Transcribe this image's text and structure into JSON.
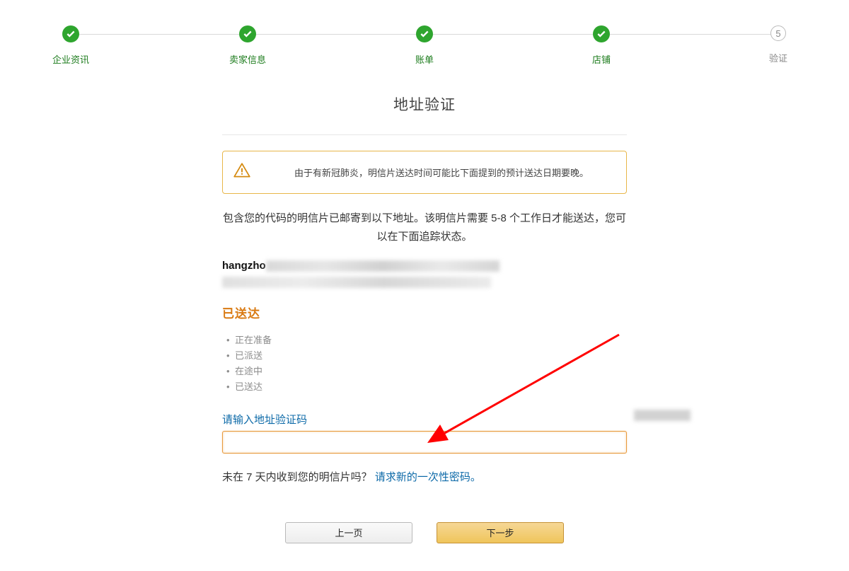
{
  "stepper": {
    "steps": [
      {
        "label": "企业资讯",
        "state": "done"
      },
      {
        "label": "卖家信息",
        "state": "done"
      },
      {
        "label": "账单",
        "state": "done"
      },
      {
        "label": "店铺",
        "state": "done"
      },
      {
        "label": "验证",
        "state": "pending",
        "number": "5"
      }
    ]
  },
  "title": "地址验证",
  "alert": {
    "text": "由于有新冠肺炎，明信片送达时间可能比下面提到的预计送达日期要晚。"
  },
  "intro": "包含您的代码的明信片已邮寄到以下地址。该明信片需要 5-8 个工作日才能送达，您可以在下面追踪状态。",
  "address": {
    "name_visible": "hangzho"
  },
  "status_title": "已送达",
  "status_items": [
    "正在准备",
    "已派送",
    "在途中",
    "已送达"
  ],
  "code": {
    "label": "请输入地址验证码",
    "value": ""
  },
  "request": {
    "prefix": "未在 7 天内收到您的明信片吗？ ",
    "link": "请求新的一次性密码。"
  },
  "buttons": {
    "prev": "上一页",
    "next": "下一步"
  }
}
